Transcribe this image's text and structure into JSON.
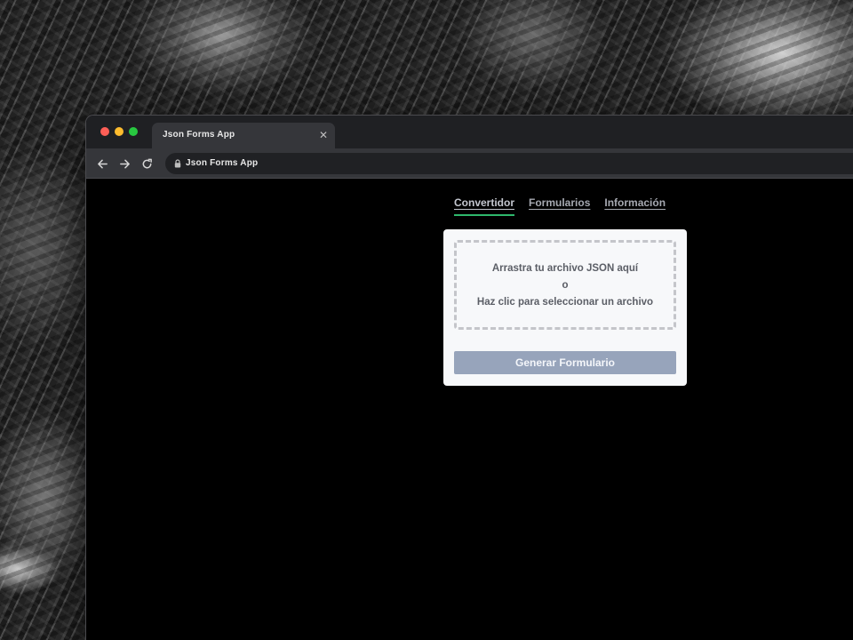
{
  "browser": {
    "tab_title": "Json Forms App",
    "address": "Json Forms App",
    "tab_close_icon": "close-icon",
    "nav_icons": [
      "arrow-left-icon",
      "arrow-right-icon",
      "reload-icon",
      "lock-icon"
    ]
  },
  "nav": {
    "items": [
      {
        "label": "Convertidor",
        "active": true
      },
      {
        "label": "Formularios",
        "active": false
      },
      {
        "label": "Información",
        "active": false
      }
    ],
    "active_color": "#2fb86c"
  },
  "upload": {
    "line1": "Arrastra tu archivo JSON aquí",
    "line2": "o",
    "line3": "Haz clic para seleccionar un archivo"
  },
  "actions": {
    "generate_label": "Generar Formulario",
    "generate_color": "#97a4bb"
  },
  "colors": {
    "page_bg": "#000000",
    "card_bg": "#f7f8fa",
    "traffic_red": "#fe5f57",
    "traffic_yellow": "#febc2e",
    "traffic_green": "#28c840"
  }
}
